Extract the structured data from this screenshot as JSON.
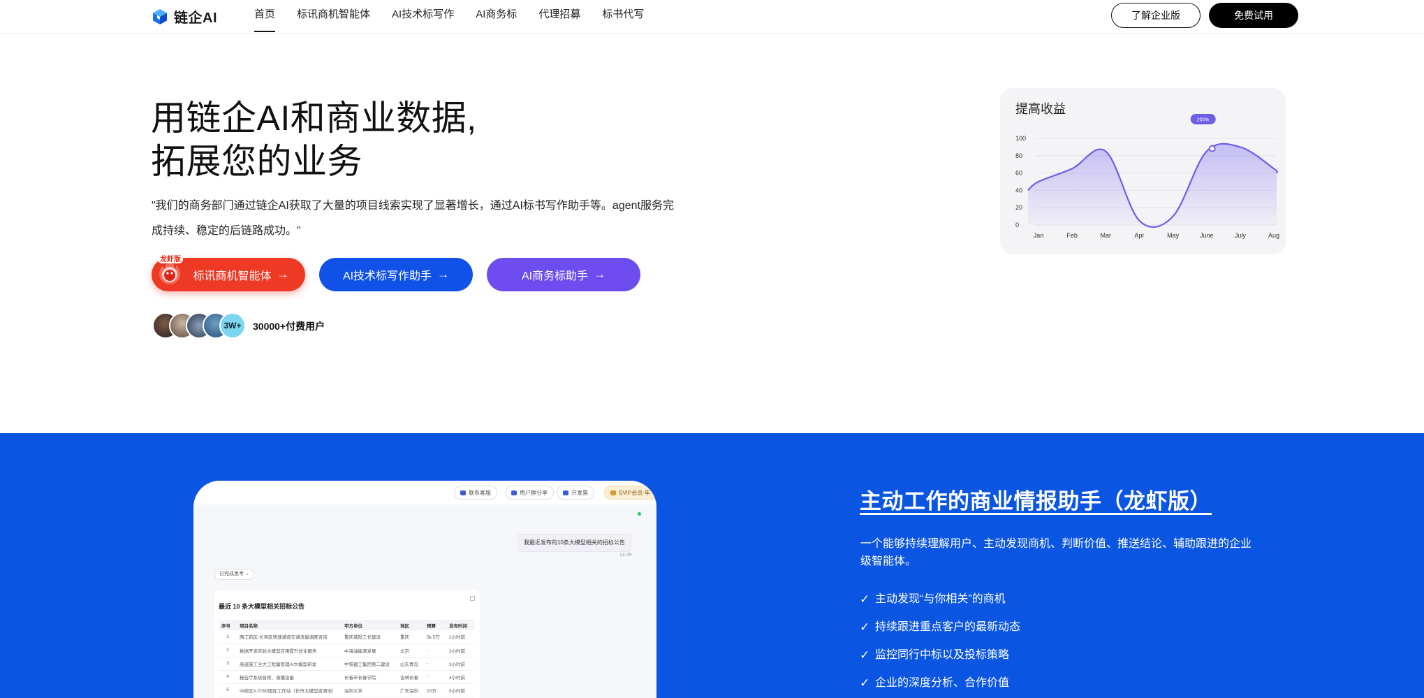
{
  "nav": {
    "logo_text": "链企AI",
    "links": [
      "首页",
      "标讯商机智能体",
      "AI技术标写作",
      "AI商务标",
      "代理招募",
      "标书代写"
    ],
    "enterprise_label": "了解企业版",
    "trial_label": "免费试用"
  },
  "hero": {
    "title_line1": "用链企AI和商业数据,",
    "title_line2": "拓展您的业务",
    "description": "\"我们的商务部门通过链企AI获取了大量的项目线索实现了显著增长，通过AI标书写作助手等。agent服务完成持续、稳定的后链路成功。\"",
    "badge": "龙虾版",
    "cta_primary": "标讯商机智能体",
    "cta_secondary": "AI技术标写作助手",
    "cta_tertiary": "AI商务标助手",
    "avatar_count": "3W+",
    "users_label": "30000+付费用户"
  },
  "chart_data": {
    "type": "area",
    "title": "提高收益",
    "categories": [
      "Jan",
      "Feb",
      "Mar",
      "Apr",
      "May",
      "June",
      "July",
      "Aug"
    ],
    "values": [
      50,
      65,
      85,
      5,
      10,
      85,
      90,
      65
    ],
    "yticks": [
      0,
      20,
      40,
      60,
      80,
      100
    ],
    "ylim": [
      0,
      100
    ],
    "highlight": {
      "category": "June",
      "label": "200%"
    },
    "grid": true,
    "color": "#6d5ee8"
  },
  "feature": {
    "toolbar": [
      "联系客服",
      "用户群分享",
      "开发票",
      "SVIP会员·年"
    ],
    "user_message": "我最近发布的10条大模型相关的招标公告",
    "message_time": "14:49",
    "thought_label": "已完成思考 ⌄",
    "result_title": "最近 10 条大模型相关招标公告",
    "columns": [
      "序号",
      "项目名称",
      "甲方单位",
      "地区",
      "预算",
      "发布时间"
    ],
    "rows": [
      [
        "1",
        "两江新区-长寿区快速通道交通流量调度咨询",
        "重庆城投工长建设",
        "重庆",
        "5k.5万",
        "2小时前"
      ],
      [
        "2",
        "数据开发实验大模型应用提升优化服务",
        "中海油能源发展",
        "北京",
        "-",
        "3小时前"
      ],
      [
        "3",
        "高速施工全大工程量管理AI大模型研发",
        "中铁建工集团第二建设",
        "山东青岛",
        "-",
        "3小时前"
      ],
      [
        "4",
        "报告厅系统音频、录播设备",
        "长春市长春学院",
        "吉林长春",
        "-",
        "4小时前"
      ],
      [
        "5",
        "中校区X-T090国际工作站（长市大模型资源池）",
        "深圳大学",
        "广东深圳",
        "20万",
        "5小时前"
      ]
    ],
    "title": "主动工作的商业情报助手（龙虾版）",
    "description": "一个能够持续理解用户、主动发现商机、判断价值、推送结论、辅助跟进的企业级智能体。",
    "points": [
      "主动发现“与你相关”的商机",
      "持续跟进重点客户的最新动态",
      "监控同行中标以及投标策略",
      "企业的深度分析、合作价值"
    ]
  },
  "colors": {
    "brand_blue": "#0a55e2",
    "cta_red": "#ee3a25",
    "cta_blue": "#1052e8",
    "cta_purple": "#6d4cf0"
  }
}
